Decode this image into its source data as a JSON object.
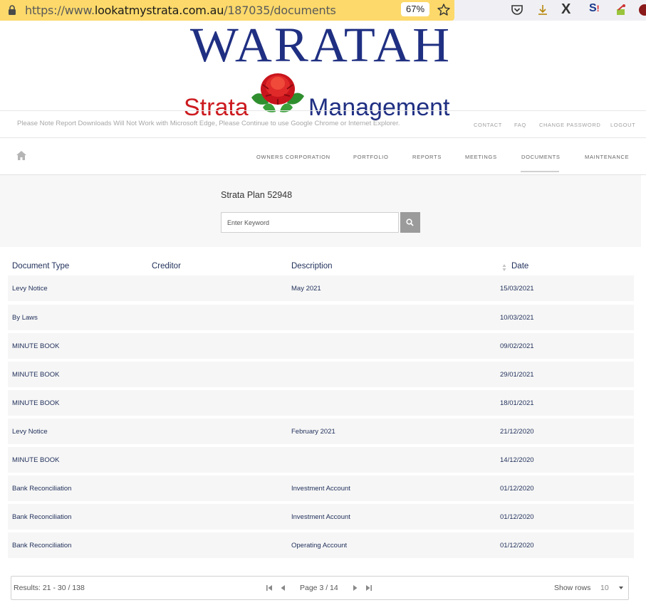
{
  "browser": {
    "url_prefix": "https://www.",
    "url_domain": "lookatmystrata.com.au",
    "url_path": "/187035/documents",
    "zoom": "67%",
    "extension_x_label": "X",
    "extension_s_label": "S"
  },
  "logo": {
    "line1": "WARATAH",
    "line2_left": "Strata",
    "line2_right": "Management"
  },
  "notice": "Please Note Report Downloads Will Not Work with Microsoft Edge, Please Continue to use Google Chrome or Internet Explorer.",
  "top_links": [
    "CONTACT",
    "FAQ",
    "CHANGE PASSWORD",
    "LOGOUT"
  ],
  "nav": {
    "items": [
      "OWNERS CORPORATION",
      "PORTFOLIO",
      "REPORTS",
      "MEETINGS",
      "DOCUMENTS",
      "MAINTENANCE"
    ],
    "active": "DOCUMENTS"
  },
  "search": {
    "title": "Strata Plan 52948",
    "placeholder": "Enter Keyword"
  },
  "table": {
    "headers": [
      "Document Type",
      "Creditor",
      "Description",
      "Date"
    ],
    "rows": [
      [
        "Levy Notice",
        "",
        "May 2021",
        "15/03/2021"
      ],
      [
        "By Laws",
        "",
        "",
        "10/03/2021"
      ],
      [
        "MINUTE BOOK",
        "",
        "",
        "09/02/2021"
      ],
      [
        "MINUTE BOOK",
        "",
        "",
        "29/01/2021"
      ],
      [
        "MINUTE BOOK",
        "",
        "",
        "18/01/2021"
      ],
      [
        "Levy Notice",
        "",
        "February 2021",
        "21/12/2020"
      ],
      [
        "MINUTE BOOK",
        "",
        "",
        "14/12/2020"
      ],
      [
        "Bank Reconciliation",
        "",
        "Investment Account",
        "01/12/2020"
      ],
      [
        "Bank Reconciliation",
        "",
        "Investment Account",
        "01/12/2020"
      ],
      [
        "Bank Reconciliation",
        "",
        "Operating Account",
        "01/12/2020"
      ]
    ]
  },
  "pager": {
    "results_label": "Results: 21 - 30 / 138",
    "page_label": "Page 3 / 14",
    "show_rows_label": "Show rows",
    "rows_value": "10"
  },
  "colors": {
    "brand_blue": "#1f2f82",
    "brand_red": "#cc1a1f",
    "url_bar": "#fcd96a"
  }
}
